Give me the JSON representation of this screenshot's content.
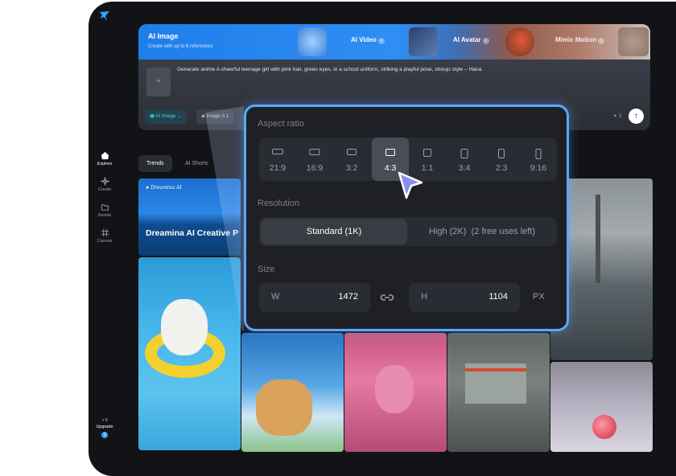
{
  "sidebar": {
    "items": [
      {
        "label": "Explore",
        "icon": "compass-icon",
        "active": true
      },
      {
        "label": "Create",
        "icon": "sparkle-icon",
        "active": false
      },
      {
        "label": "Assets",
        "icon": "folder-icon",
        "active": false
      },
      {
        "label": "Canvas",
        "icon": "grid-icon",
        "active": false
      }
    ],
    "upgrade_label": "Upgrade",
    "upgrade_count": "+ 0",
    "notification_badge": "1"
  },
  "hero": {
    "title": "AI Image",
    "subtitle": "Create with up to 6 references",
    "tabs": [
      {
        "label": "AI Video"
      },
      {
        "label": "AI Avatar"
      },
      {
        "label": "Mimic Motion"
      }
    ],
    "upload_icon": "+",
    "prompt": "Generate anime A cheerful teenage girl with pink hair, green eyes, in a school uniform, striking a playful pose, shoujo style – Hana.",
    "chips": {
      "model": "AI Image",
      "version": "image 3.1"
    },
    "credits": "3",
    "send_icon": "arrow-up-icon"
  },
  "feed_tabs": [
    {
      "label": "Trends",
      "active": true
    },
    {
      "label": "AI Shorts",
      "active": false
    }
  ],
  "banner": {
    "logo_text": "Dreamina AI",
    "headline": "Dreamina AI Creative P"
  },
  "popup": {
    "aspect_label": "Aspect ratio",
    "ratios": [
      "21:9",
      "16:9",
      "3:2",
      "4:3",
      "1:1",
      "3:4",
      "2:3",
      "9:16"
    ],
    "selected_ratio": "4:3",
    "resolution_label": "Resolution",
    "resolution_options": [
      "Standard (1K)",
      "High (2K)  (2 free uses left)"
    ],
    "selected_resolution": "Standard (1K)",
    "size_label": "Size",
    "width_key": "W",
    "width_value": "1472",
    "height_key": "H",
    "height_value": "1104",
    "unit": "PX"
  },
  "colors": {
    "accent": "#5aa8ff",
    "background": "#121316",
    "panel": "#1f2026",
    "chip_active_text": "#45d4e8"
  }
}
